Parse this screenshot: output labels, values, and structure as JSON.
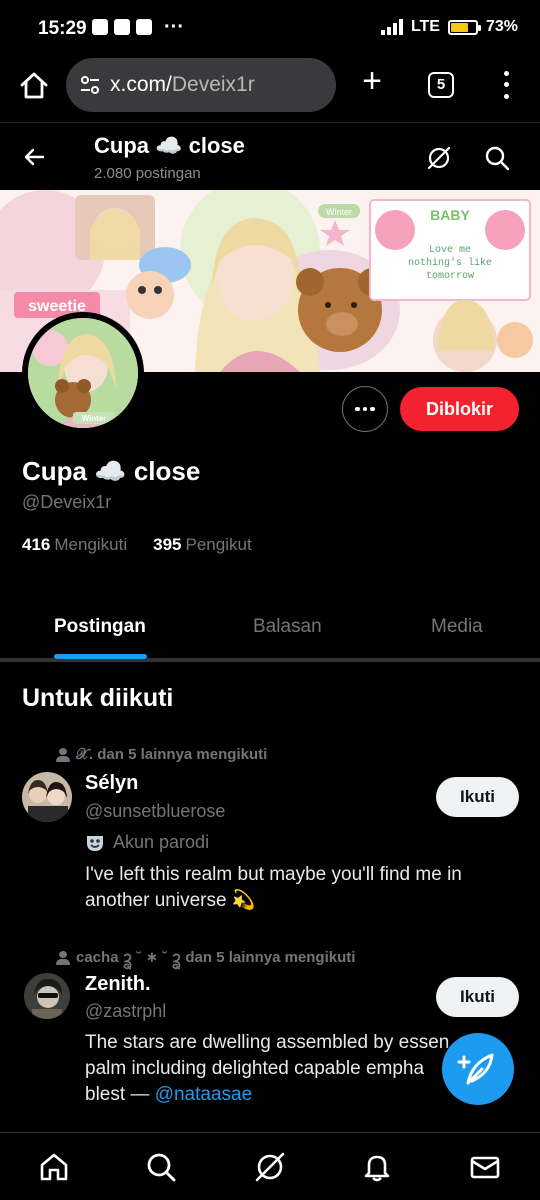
{
  "status_bar": {
    "time": "15:29",
    "network": "LTE",
    "battery": "73%",
    "battery_level": 0.73,
    "battery_color": "#f5c518"
  },
  "browser": {
    "url_domain": "x.com/",
    "url_path": "Deveix1r",
    "tab_count": "5"
  },
  "header": {
    "title": "Cupa ☁️ close",
    "post_count": "2.080 postingan"
  },
  "banner": {
    "sticker_winter": "Winter",
    "sticker_baby": "BABY",
    "note_line1": "Love me",
    "note_line2": "nothing's like",
    "note_line3": "tomorrow",
    "sweetie": "sweetie"
  },
  "avatar": {
    "caption": "Winter"
  },
  "actions": {
    "blocked_label": "Diblokir"
  },
  "profile": {
    "name": "Cupa ☁️ close",
    "handle": "@Deveix1r",
    "following_count": "416",
    "following_label": "Mengikuti",
    "followers_count": "395",
    "followers_label": "Pengikut"
  },
  "tabs": [
    {
      "label": "Postingan",
      "active": true
    },
    {
      "label": "Balasan",
      "active": false
    },
    {
      "label": "Media",
      "active": false
    }
  ],
  "section": {
    "title": "Untuk diikuti"
  },
  "suggestions": [
    {
      "context": "𝒳. dan 5 lainnya mengikuti",
      "name": "Sélyn",
      "handle": "@sunsetbluerose",
      "label": "Akun parodi",
      "bio": "I've left this realm but maybe you'll find me in another universe 💫",
      "follow_label": "Ikuti"
    },
    {
      "context": "cacha ᩄ ˘ ∗ ˘ ᩄ dan 5 lainnya mengikuti",
      "name": "Zenith.",
      "handle": "@zastrphl",
      "bio_text": "The stars are dwelling assembled by essen palm including delighted capable empha blest — ",
      "bio_mention": "@nataasae",
      "follow_label": "Ikuti"
    }
  ],
  "colors": {
    "accent": "#1d9bf0",
    "blocked": "#f4212e",
    "background": "#000000",
    "muted_text": "#71767b"
  },
  "icons": {
    "nav": [
      "home-icon",
      "search-icon",
      "grok-icon",
      "notifications-icon",
      "messages-icon"
    ],
    "fab": "compose-post-icon"
  }
}
